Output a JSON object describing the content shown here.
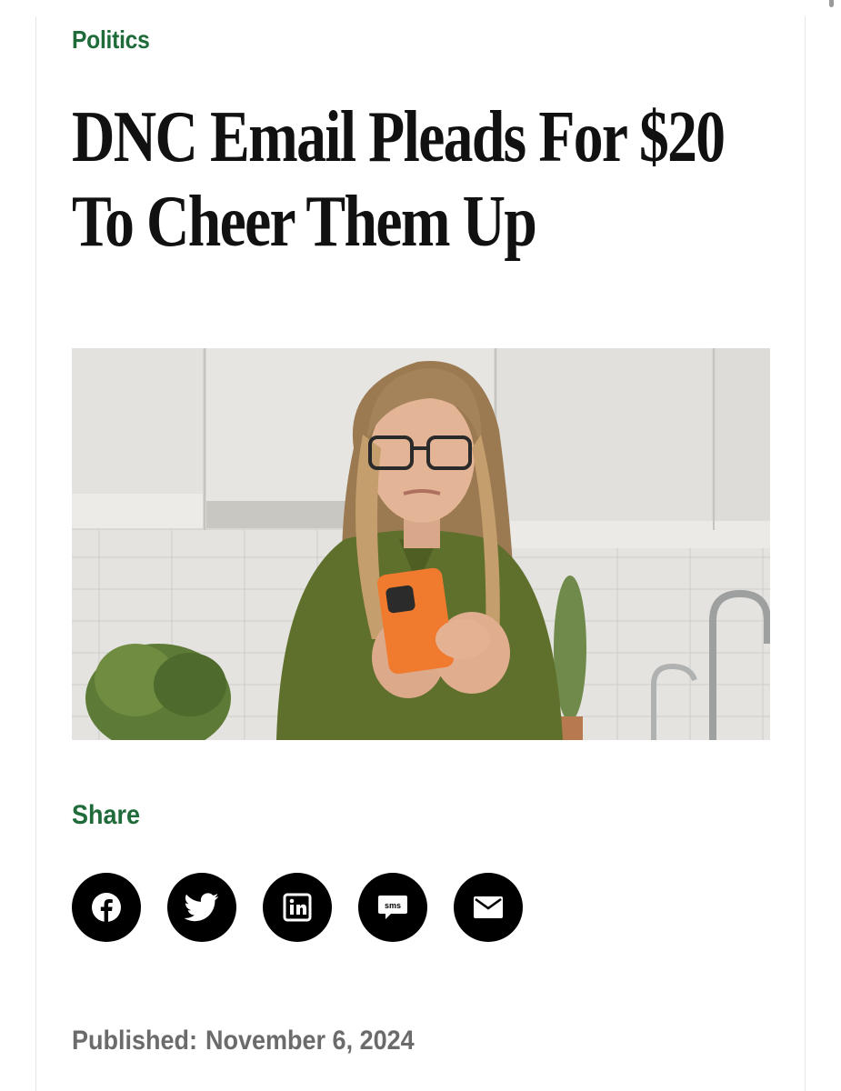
{
  "article": {
    "category": "Politics",
    "headline": "DNC Email Pleads For $20 To Cheer Them Up",
    "image_alt": "Woman looking at an orange phone in a kitchen",
    "share_label": "Share",
    "share_buttons": [
      {
        "icon": "facebook-icon",
        "label": "Facebook"
      },
      {
        "icon": "twitter-icon",
        "label": "Twitter"
      },
      {
        "icon": "linkedin-icon",
        "label": "LinkedIn"
      },
      {
        "icon": "sms-icon",
        "label": "sms"
      },
      {
        "icon": "email-icon",
        "label": "Email"
      }
    ],
    "published_label": "Published:",
    "published_date": "November 6, 2024"
  },
  "colors": {
    "accent": "#1f6b3a",
    "headline": "#111111",
    "meta": "#6b6b6b",
    "share_button": "#000000"
  }
}
